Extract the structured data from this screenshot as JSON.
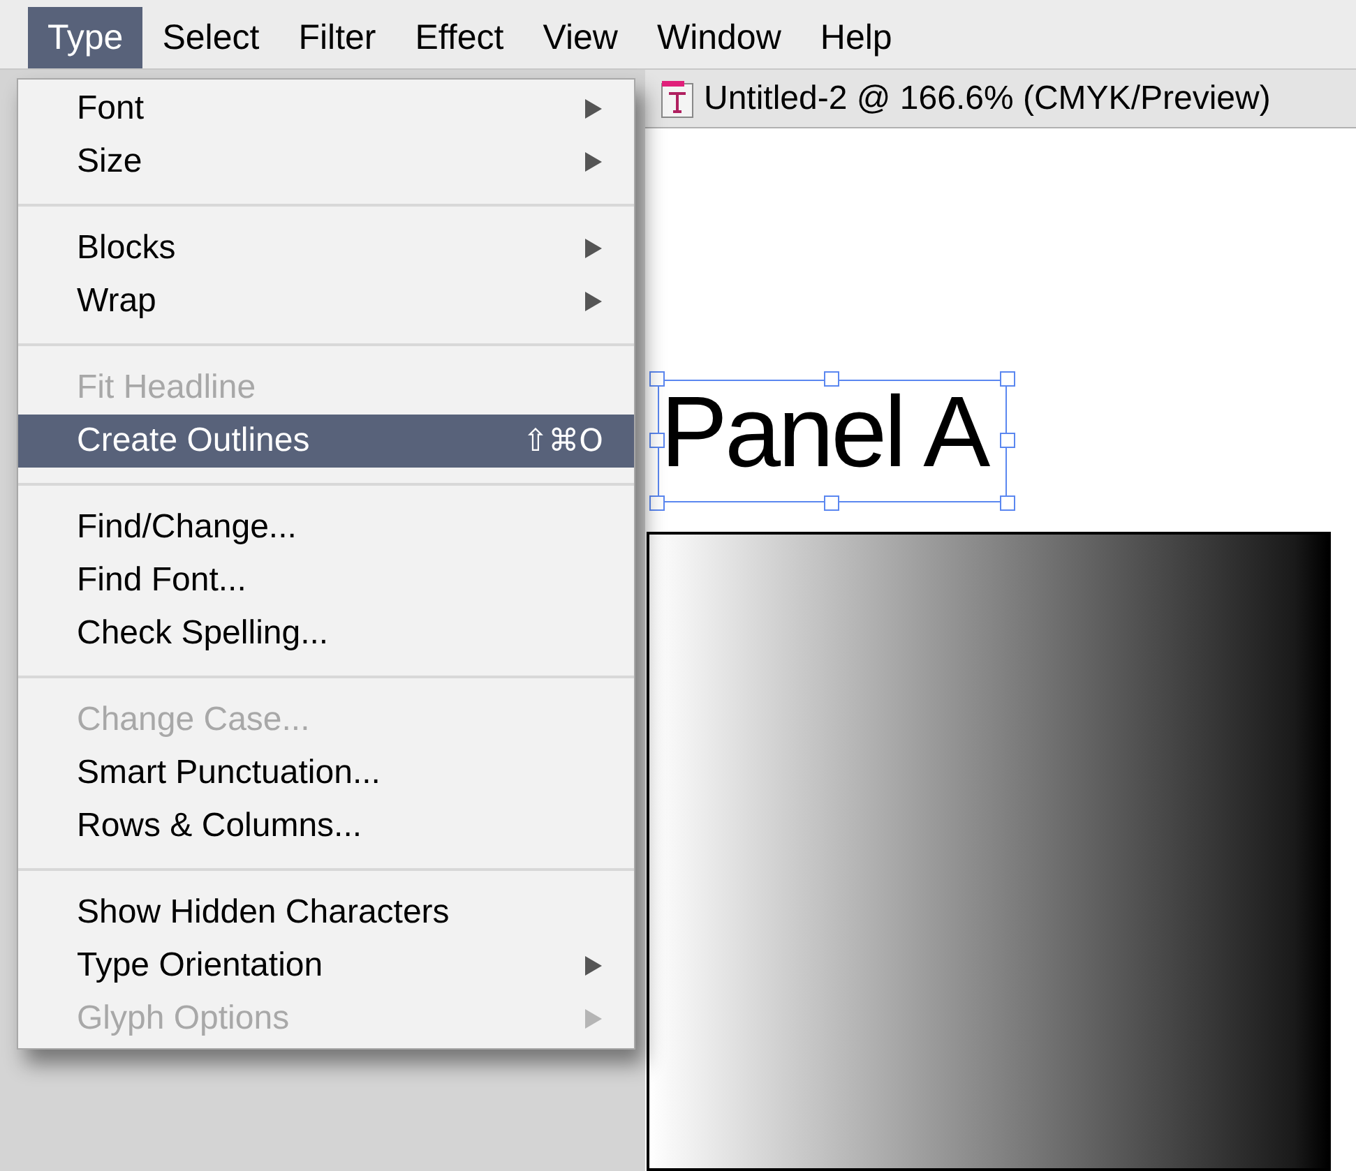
{
  "menu_bar": [
    {
      "label": "Type",
      "selected": true
    },
    {
      "label": "Select",
      "selected": false
    },
    {
      "label": "Filter",
      "selected": false
    },
    {
      "label": "Effect",
      "selected": false
    },
    {
      "label": "View",
      "selected": false
    },
    {
      "label": "Window",
      "selected": false
    },
    {
      "label": "Help",
      "selected": false
    }
  ],
  "menu": {
    "groups": [
      [
        {
          "label": "Font",
          "disabled": false,
          "selected": false,
          "submenu": true
        },
        {
          "label": "Size",
          "disabled": false,
          "selected": false,
          "submenu": true
        }
      ],
      [
        {
          "label": "Blocks",
          "disabled": false,
          "selected": false,
          "submenu": true
        },
        {
          "label": "Wrap",
          "disabled": false,
          "selected": false,
          "submenu": true
        }
      ],
      [
        {
          "label": "Fit Headline",
          "disabled": true,
          "selected": false,
          "submenu": false
        },
        {
          "label": "Create Outlines",
          "disabled": false,
          "selected": true,
          "submenu": false,
          "shortcut": "⇧⌘O"
        }
      ],
      [
        {
          "label": "Find/Change...",
          "disabled": false,
          "selected": false,
          "submenu": false
        },
        {
          "label": "Find Font...",
          "disabled": false,
          "selected": false,
          "submenu": false
        },
        {
          "label": "Check Spelling...",
          "disabled": false,
          "selected": false,
          "submenu": false
        }
      ],
      [
        {
          "label": "Change Case...",
          "disabled": true,
          "selected": false,
          "submenu": false
        },
        {
          "label": "Smart Punctuation...",
          "disabled": false,
          "selected": false,
          "submenu": false
        },
        {
          "label": "Rows & Columns...",
          "disabled": false,
          "selected": false,
          "submenu": false
        }
      ],
      [
        {
          "label": "Show Hidden Characters",
          "disabled": false,
          "selected": false,
          "submenu": false
        },
        {
          "label": "Type Orientation",
          "disabled": false,
          "selected": false,
          "submenu": true
        },
        {
          "label": "Glyph Options",
          "disabled": true,
          "selected": false,
          "submenu": true
        }
      ]
    ]
  },
  "document": {
    "title": "Untitled-2 @ 166.6% (CMYK/Preview)"
  },
  "canvas": {
    "text_frame": {
      "text": "Panel A",
      "selected": true
    }
  }
}
